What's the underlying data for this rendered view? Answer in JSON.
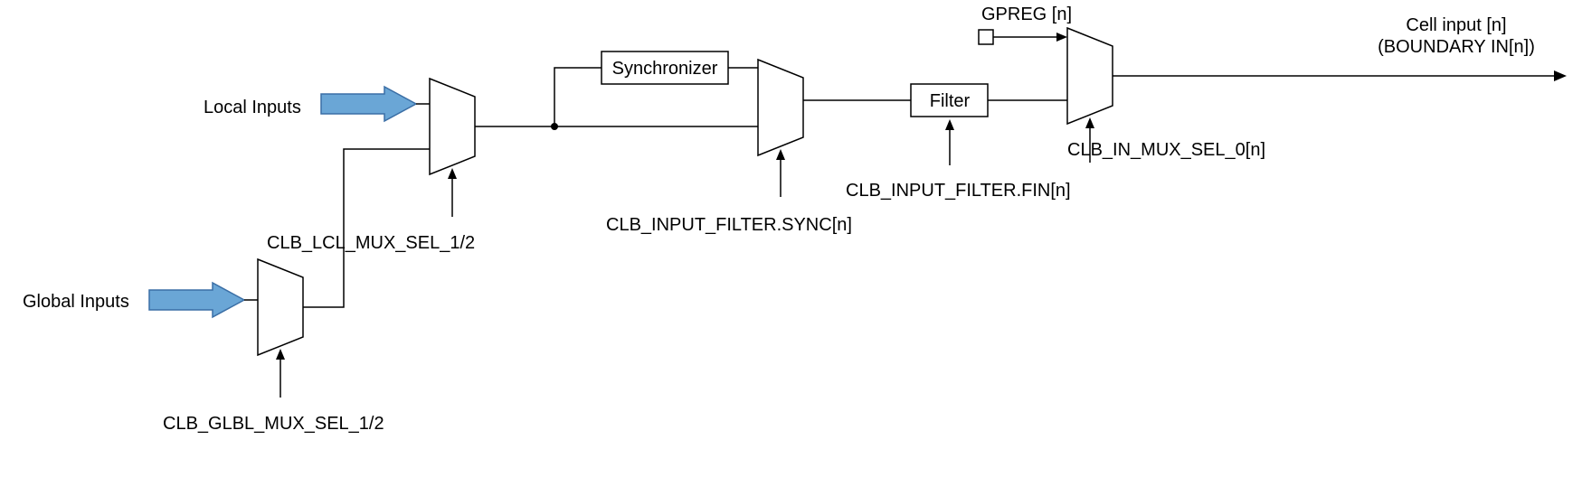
{
  "labels": {
    "global_inputs": "Global Inputs",
    "local_inputs": "Local Inputs",
    "glbl_mux": "CLB_GLBL_MUX_SEL_1/2",
    "lcl_mux": "CLB_LCL_MUX_SEL_1/2",
    "synchronizer": "Synchronizer",
    "filter": "Filter",
    "sync_ctrl": "CLB_INPUT_FILTER.SYNC[n]",
    "fin_ctrl": "CLB_INPUT_FILTER.FIN[n]",
    "gpreg": "GPREG [n]",
    "in_mux": "CLB_IN_MUX_SEL_0[n]",
    "cell_input_1": "Cell input [n]",
    "cell_input_2": "(BOUNDARY IN[n])"
  }
}
